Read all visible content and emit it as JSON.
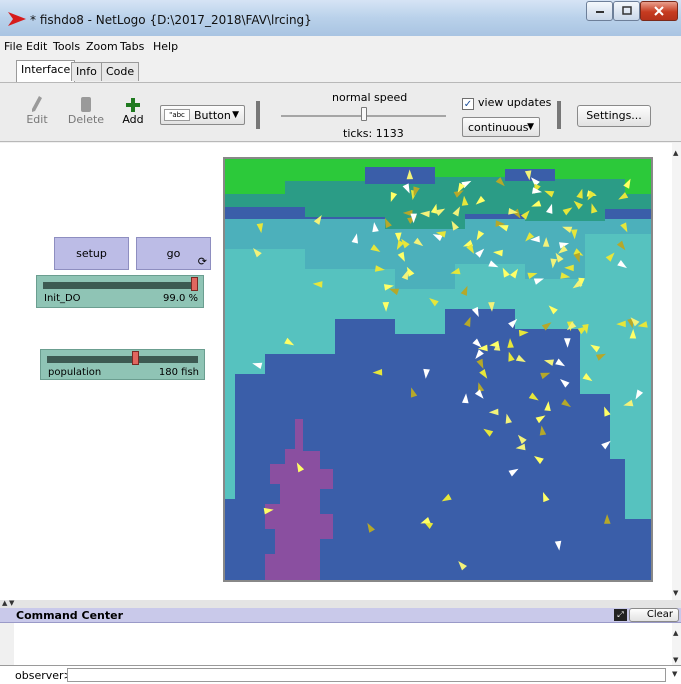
{
  "window": {
    "title": "* fishdo8 - NetLogo {D:\\2017_2018\\FAV\\lrcing}"
  },
  "menu": [
    "File",
    "Edit",
    "Tools",
    "Zoom",
    "Tabs",
    "Help"
  ],
  "tabs": [
    "Interface",
    "Info",
    "Code"
  ],
  "toolbar": {
    "edit": "Edit",
    "delete": "Delete",
    "add": "Add",
    "widget_type": "Button",
    "speed_label": "normal speed",
    "ticks": "ticks: 1133",
    "view_updates": "view updates",
    "view_updates_checked": true,
    "update_mode": "continuous",
    "settings": "Settings..."
  },
  "widgets": {
    "setup": "setup",
    "go": "go",
    "init_do": {
      "name": "Init_DO",
      "value": "99.0 %",
      "fraction": 0.99
    },
    "population": {
      "name": "population",
      "value": "180 fish",
      "fraction": 0.58
    }
  },
  "command_center": {
    "title": "Command Center",
    "clear": "Clear",
    "prompt": "observer>"
  },
  "colors": {
    "button": "#bcbce6",
    "slider": "#8fc4b5",
    "surface_green": "#2cc93a",
    "zone_teal": "#2b9c86",
    "zone_aqua": "#56c2bf",
    "deep_blue": "#3a5ea9",
    "sediment": "#8a4fa0"
  }
}
